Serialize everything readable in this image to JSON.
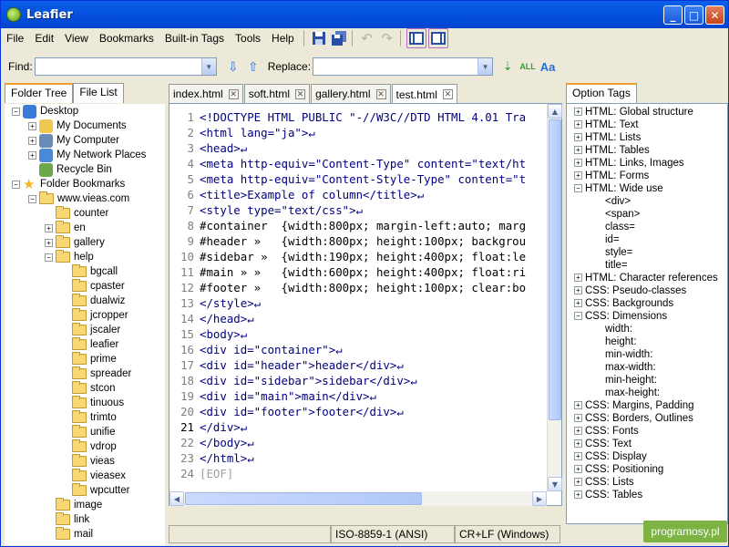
{
  "window": {
    "title": "Leafier"
  },
  "menu": [
    "File",
    "Edit",
    "View",
    "Bookmarks",
    "Built-in Tags",
    "Tools",
    "Help"
  ],
  "find": {
    "label": "Find:",
    "value": "",
    "replace_label": "Replace:",
    "replace_value": ""
  },
  "left_tabs": [
    "Folder Tree",
    "File List"
  ],
  "tree": [
    {
      "label": "Desktop",
      "level": 0,
      "exp": "-",
      "icon": "desktop"
    },
    {
      "label": "My Documents",
      "level": 1,
      "exp": "+",
      "icon": "docs"
    },
    {
      "label": "My Computer",
      "level": 1,
      "exp": "+",
      "icon": "computer"
    },
    {
      "label": "My Network Places",
      "level": 1,
      "exp": "+",
      "icon": "network"
    },
    {
      "label": "Recycle Bin",
      "level": 1,
      "exp": "",
      "icon": "recycle"
    },
    {
      "label": "Folder Bookmarks",
      "level": 0,
      "exp": "-",
      "icon": "star"
    },
    {
      "label": "www.vieas.com",
      "level": 1,
      "exp": "-",
      "icon": "folder"
    },
    {
      "label": "counter",
      "level": 2,
      "exp": "",
      "icon": "folder"
    },
    {
      "label": "en",
      "level": 2,
      "exp": "+",
      "icon": "folder"
    },
    {
      "label": "gallery",
      "level": 2,
      "exp": "+",
      "icon": "folder"
    },
    {
      "label": "help",
      "level": 2,
      "exp": "-",
      "icon": "folder"
    },
    {
      "label": "bgcall",
      "level": 3,
      "exp": "",
      "icon": "folder"
    },
    {
      "label": "cpaster",
      "level": 3,
      "exp": "",
      "icon": "folder"
    },
    {
      "label": "dualwiz",
      "level": 3,
      "exp": "",
      "icon": "folder"
    },
    {
      "label": "jcropper",
      "level": 3,
      "exp": "",
      "icon": "folder"
    },
    {
      "label": "jscaler",
      "level": 3,
      "exp": "",
      "icon": "folder"
    },
    {
      "label": "leafier",
      "level": 3,
      "exp": "",
      "icon": "folder"
    },
    {
      "label": "prime",
      "level": 3,
      "exp": "",
      "icon": "folder"
    },
    {
      "label": "spreader",
      "level": 3,
      "exp": "",
      "icon": "folder"
    },
    {
      "label": "stcon",
      "level": 3,
      "exp": "",
      "icon": "folder"
    },
    {
      "label": "tinuous",
      "level": 3,
      "exp": "",
      "icon": "folder"
    },
    {
      "label": "trimto",
      "level": 3,
      "exp": "",
      "icon": "folder"
    },
    {
      "label": "unifie",
      "level": 3,
      "exp": "",
      "icon": "folder"
    },
    {
      "label": "vdrop",
      "level": 3,
      "exp": "",
      "icon": "folder"
    },
    {
      "label": "vieas",
      "level": 3,
      "exp": "",
      "icon": "folder"
    },
    {
      "label": "vieasex",
      "level": 3,
      "exp": "",
      "icon": "folder"
    },
    {
      "label": "wpcutter",
      "level": 3,
      "exp": "",
      "icon": "folder"
    },
    {
      "label": "image",
      "level": 2,
      "exp": "",
      "icon": "folder"
    },
    {
      "label": "link",
      "level": 2,
      "exp": "",
      "icon": "folder"
    },
    {
      "label": "mail",
      "level": 2,
      "exp": "",
      "icon": "folder"
    }
  ],
  "editor_tabs": [
    {
      "label": "index.html",
      "active": false
    },
    {
      "label": "soft.html",
      "active": false
    },
    {
      "label": "gallery.html",
      "active": false
    },
    {
      "label": "test.html",
      "active": true
    }
  ],
  "code_lines": [
    "<!DOCTYPE HTML PUBLIC \"-//W3C//DTD HTML 4.01 Tra",
    "<html lang=\"ja\">↵",
    "<head>↵",
    "<meta http-equiv=\"Content-Type\" content=\"text/ht",
    "<meta http-equiv=\"Content-Style-Type\" content=\"t",
    "<title>Example of column</title>↵",
    "<style type=\"text/css\">↵",
    "#container  {width:800px; margin-left:auto; marg",
    "#header »   {width:800px; height:100px; backgrou",
    "#sidebar »  {width:190px; height:400px; float:le",
    "#main » »   {width:600px; height:400px; float:ri",
    "#footer »   {width:800px; height:100px; clear:bo",
    "</style>↵",
    "</head>↵",
    "<body>↵",
    "<div id=\"container\">↵",
    "<div id=\"header\">header</div>↵",
    "<div id=\"sidebar\">sidebar</div>↵",
    "<div id=\"main\">main</div>↵",
    "<div id=\"footer\">footer</div>↵",
    "</div>↵",
    "</body>↵",
    "</html>↵",
    "[EOF]"
  ],
  "current_line": 21,
  "status": {
    "encoding": "ISO-8859-1 (ANSI)",
    "eol": "CR+LF (Windows)"
  },
  "right_tab": "Option Tags",
  "options": [
    {
      "label": "HTML: Global structure",
      "exp": "+",
      "child": false
    },
    {
      "label": "HTML: Text",
      "exp": "+",
      "child": false
    },
    {
      "label": "HTML: Lists",
      "exp": "+",
      "child": false
    },
    {
      "label": "HTML: Tables",
      "exp": "+",
      "child": false
    },
    {
      "label": "HTML: Links, Images",
      "exp": "+",
      "child": false
    },
    {
      "label": "HTML: Forms",
      "exp": "+",
      "child": false
    },
    {
      "label": "HTML: Wide use",
      "exp": "-",
      "child": false
    },
    {
      "label": "<div>",
      "exp": "",
      "child": true
    },
    {
      "label": "<span>",
      "exp": "",
      "child": true
    },
    {
      "label": "class=",
      "exp": "",
      "child": true
    },
    {
      "label": "id=",
      "exp": "",
      "child": true
    },
    {
      "label": "style=",
      "exp": "",
      "child": true
    },
    {
      "label": "title=",
      "exp": "",
      "child": true
    },
    {
      "label": "HTML: Character references",
      "exp": "+",
      "child": false
    },
    {
      "label": "CSS: Pseudo-classes",
      "exp": "+",
      "child": false
    },
    {
      "label": "CSS: Backgrounds",
      "exp": "+",
      "child": false
    },
    {
      "label": "CSS: Dimensions",
      "exp": "-",
      "child": false
    },
    {
      "label": "width:",
      "exp": "",
      "child": true
    },
    {
      "label": "height:",
      "exp": "",
      "child": true
    },
    {
      "label": "min-width:",
      "exp": "",
      "child": true
    },
    {
      "label": "max-width:",
      "exp": "",
      "child": true
    },
    {
      "label": "min-height:",
      "exp": "",
      "child": true
    },
    {
      "label": "max-height:",
      "exp": "",
      "child": true
    },
    {
      "label": "CSS: Margins, Padding",
      "exp": "+",
      "child": false
    },
    {
      "label": "CSS: Borders, Outlines",
      "exp": "+",
      "child": false
    },
    {
      "label": "CSS: Fonts",
      "exp": "+",
      "child": false
    },
    {
      "label": "CSS: Text",
      "exp": "+",
      "child": false
    },
    {
      "label": "CSS: Display",
      "exp": "+",
      "child": false
    },
    {
      "label": "CSS: Positioning",
      "exp": "+",
      "child": false
    },
    {
      "label": "CSS: Lists",
      "exp": "+",
      "child": false
    },
    {
      "label": "CSS: Tables",
      "exp": "+",
      "child": false
    }
  ],
  "watermark": "programosy.pl"
}
